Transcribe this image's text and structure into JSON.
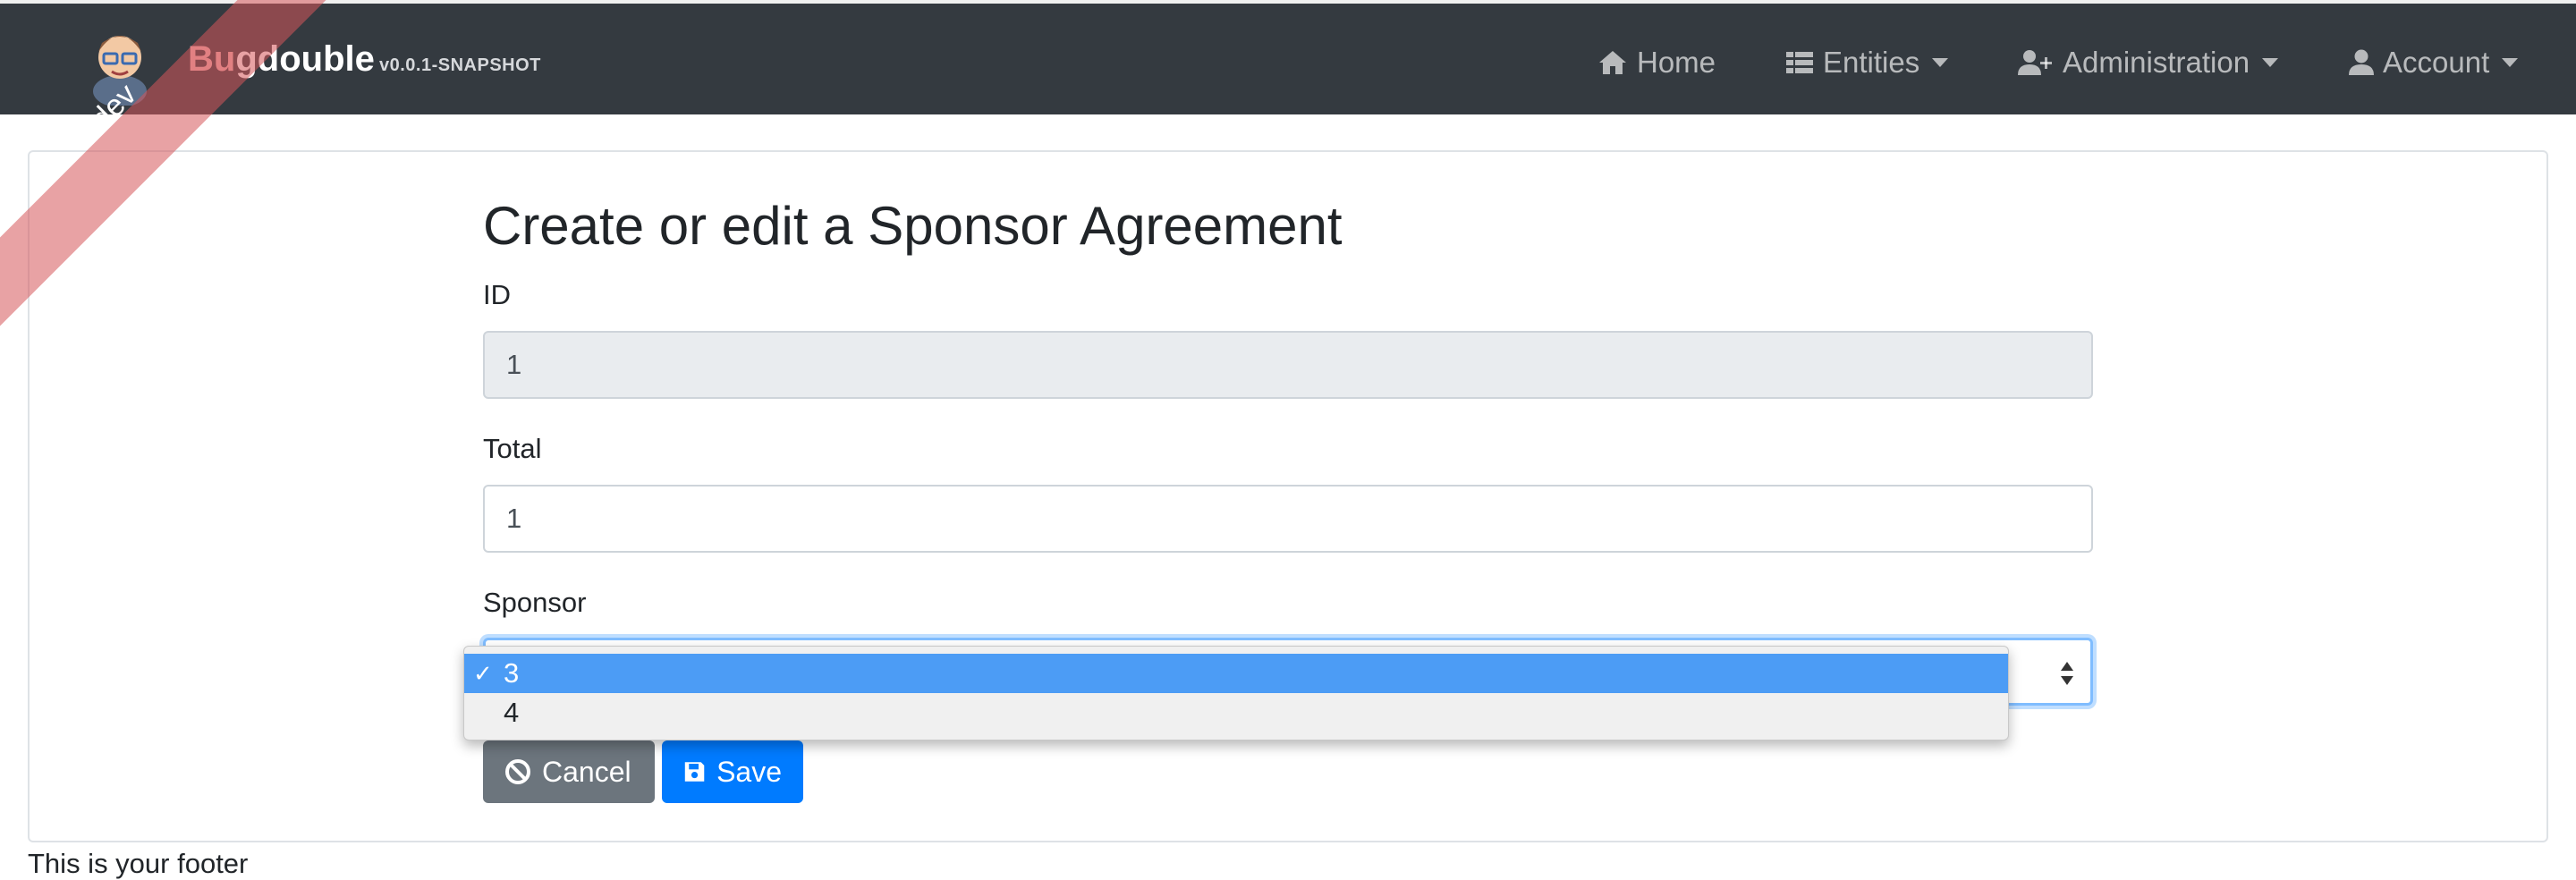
{
  "navbar": {
    "brand_prefix": "Bu",
    "brand_rest": "gdouble",
    "version": "v0.0.1-SNAPSHOT",
    "items": [
      {
        "label": "Home",
        "icon": "home-icon"
      },
      {
        "label": "Entities",
        "icon": "list-icon"
      },
      {
        "label": "Administration",
        "icon": "user-plus-icon"
      },
      {
        "label": "Account",
        "icon": "user-icon"
      }
    ]
  },
  "ribbon": {
    "label": "dev"
  },
  "form": {
    "title": "Create or edit a Sponsor Agreement",
    "id_label": "ID",
    "id_value": "1",
    "total_label": "Total",
    "total_value": "1",
    "sponsor_label": "Sponsor",
    "sponsor_options": [
      {
        "label": "3",
        "selected": true
      },
      {
        "label": "4",
        "selected": false
      }
    ],
    "check_mark": "✓",
    "cancel_label": "Cancel",
    "save_label": "Save"
  },
  "footer": {
    "text": "This is your footer"
  },
  "colors": {
    "navbar": "#343a40",
    "primary": "#007bff",
    "secondary": "#6c757d",
    "selected_option": "#4c9cf5",
    "ribbon": "#d5555a"
  }
}
